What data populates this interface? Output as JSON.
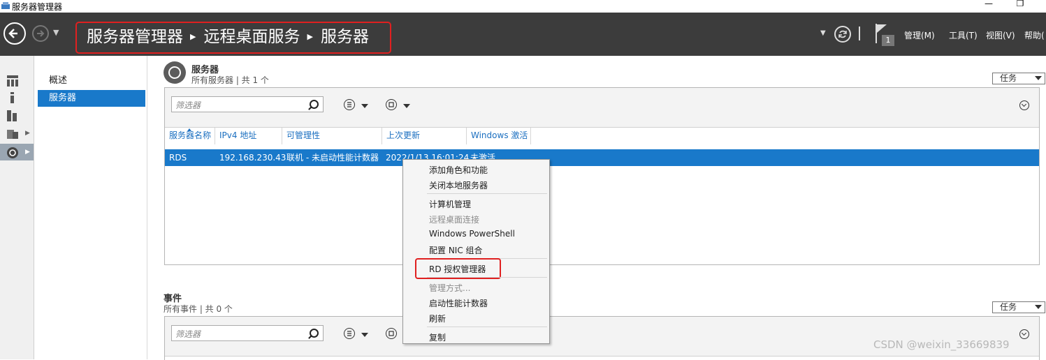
{
  "window": {
    "title": "服务器管理器",
    "minimize": "—",
    "maximize": "❐"
  },
  "header": {
    "breadcrumb": [
      "服务器管理器",
      "远程桌面服务",
      "服务器"
    ],
    "notification_count": "1",
    "menus": [
      "管理(M)",
      "工具(T)",
      "视图(V)",
      "帮助("
    ]
  },
  "subnav": {
    "items": [
      {
        "label": "概述",
        "selected": false
      },
      {
        "label": "服务器",
        "selected": true
      }
    ]
  },
  "servers_section": {
    "title": "服务器",
    "subtitle": "所有服务器 | 共 1 个",
    "tasks_label": "任务",
    "filter_placeholder": "筛选器",
    "columns": [
      "服务器名称",
      "IPv4 地址",
      "可管理性",
      "上次更新",
      "Windows 激活"
    ],
    "rows": [
      {
        "name": "RDS",
        "ipv4": "192.168.230.43",
        "manageability": "联机 - 未启动性能计数器",
        "last_update": "2022/1/13 16:01:24",
        "activation": "未激活"
      }
    ]
  },
  "events_section": {
    "title": "事件",
    "subtitle": "所有事件 | 共 0 个",
    "tasks_label": "任务",
    "filter_placeholder": "筛选器"
  },
  "context_menu": {
    "items": [
      {
        "label": "添加角色和功能",
        "disabled": false
      },
      {
        "label": "关闭本地服务器",
        "disabled": false
      },
      {
        "label": "计算机管理",
        "disabled": false
      },
      {
        "label": "远程桌面连接",
        "disabled": true
      },
      {
        "label": "Windows PowerShell",
        "disabled": false
      },
      {
        "label": "配置 NIC 组合",
        "disabled": false
      },
      {
        "label": "RD 授权管理器",
        "disabled": false,
        "highlighted": true
      },
      {
        "label": "管理方式...",
        "disabled": true
      },
      {
        "label": "启动性能计数器",
        "disabled": false
      },
      {
        "label": "刷新",
        "disabled": false
      },
      {
        "label": "复制",
        "disabled": false
      }
    ]
  },
  "watermark": "CSDN @weixin_33669839",
  "colors": {
    "header_bg": "#3c3c3c",
    "selection_blue": "#1979ca",
    "highlight_red": "#e02020",
    "link_blue": "#1b6fc0"
  }
}
